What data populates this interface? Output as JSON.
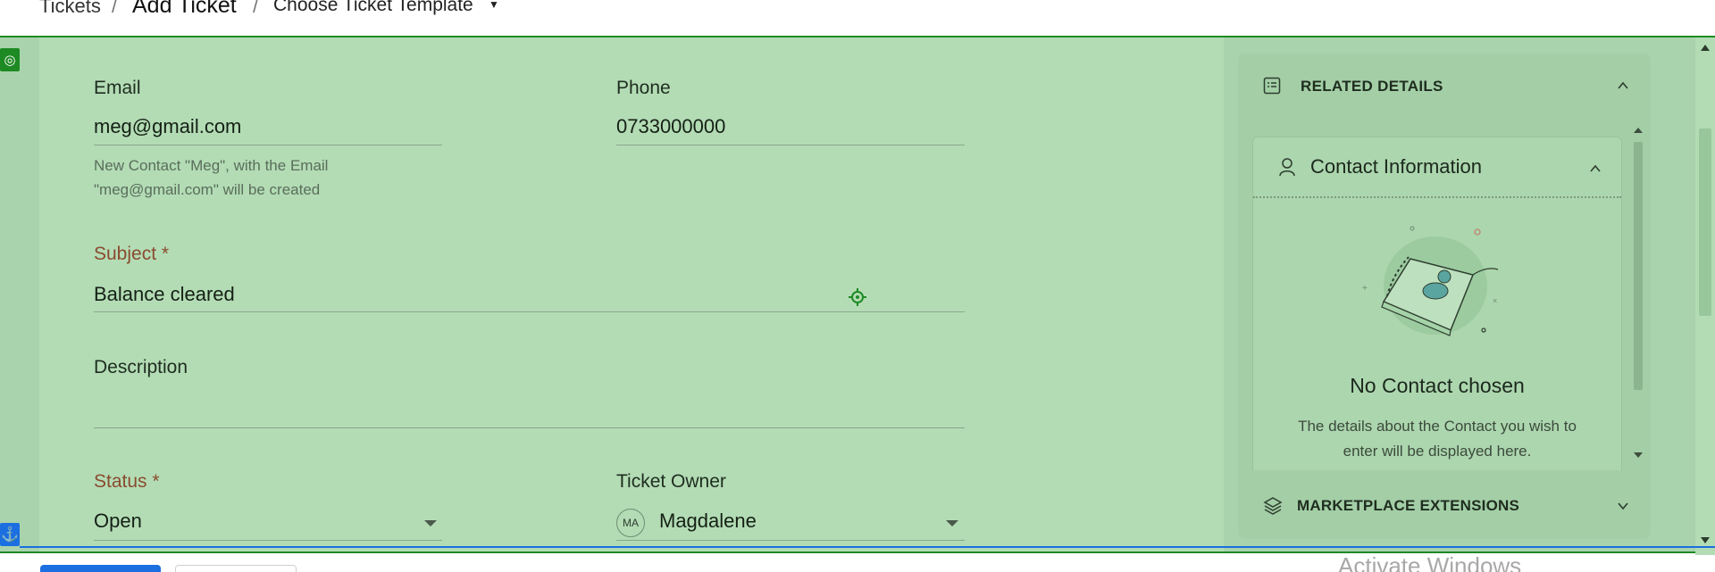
{
  "breadcrumb": {
    "tickets": "Tickets",
    "separator": "/",
    "add_ticket": "Add Ticket",
    "template": "Choose Ticket Template"
  },
  "form": {
    "email": {
      "label": "Email",
      "value": "meg@gmail.com",
      "hint": "New Contact \"Meg\", with the Email \"meg@gmail.com\" will be created"
    },
    "phone": {
      "label": "Phone",
      "value": "0733000000"
    },
    "subject": {
      "label": "Subject *",
      "value": "Balance cleared"
    },
    "description": {
      "label": "Description",
      "value": ""
    },
    "status": {
      "label": "Status *",
      "value": "Open"
    },
    "ticket_owner": {
      "label": "Ticket Owner",
      "initials": "MA",
      "value": "Magdalene"
    }
  },
  "related_panel": {
    "title": "RELATED DETAILS",
    "contact_card": {
      "title": "Contact Information",
      "empty_title": "No Contact chosen",
      "empty_desc": "The details about the Contact you wish to enter will be displayed here."
    },
    "marketplace": {
      "title": "MARKETPLACE EXTENSIONS"
    }
  },
  "watermark": "Activate Windows",
  "colors": {
    "overlay": "#b3dcb5",
    "accent_green": "#1e8a24",
    "accent_blue": "#1b6fe0",
    "required_label": "#8a4b2e"
  }
}
